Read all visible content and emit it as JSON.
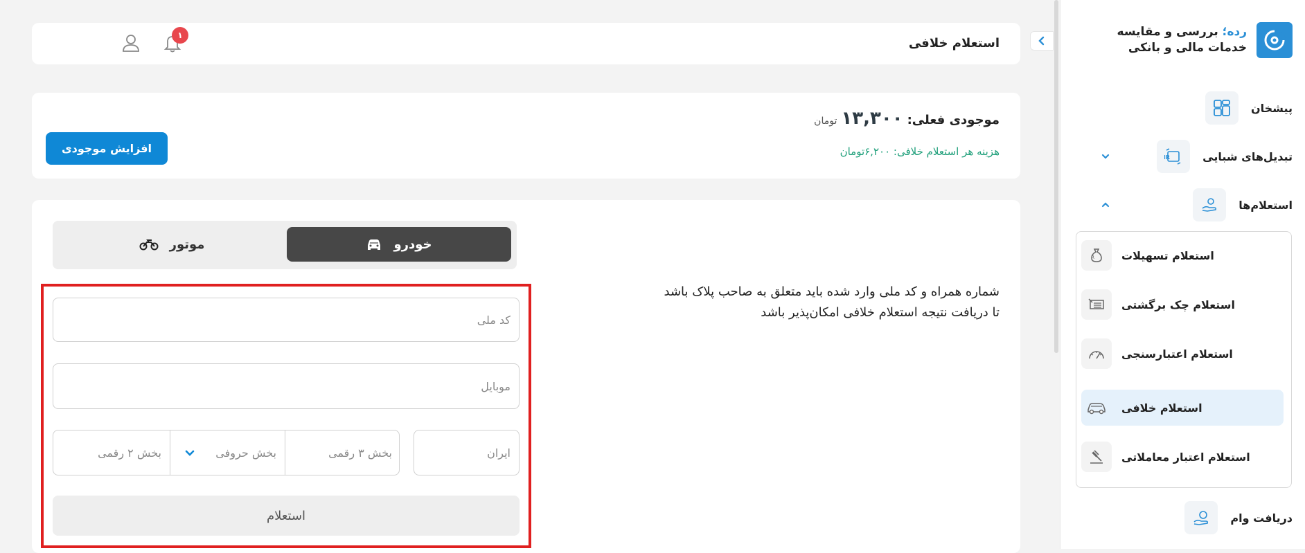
{
  "brand": {
    "accent": "رده؛",
    "line1_rest": "بررسی و مقایسه",
    "line2": "خدمات مالی و بانکی",
    "logo_icon": "disc-logo-icon"
  },
  "sidebar": {
    "items": [
      {
        "label": "پیشخان",
        "icon": "dashboard-icon"
      },
      {
        "label": "تبدیل‌های شبایی",
        "icon": "iban-convert-icon",
        "chevron": "down"
      },
      {
        "label": "استعلام‌ها",
        "icon": "hand-coin-icon",
        "chevron": "up"
      }
    ],
    "submenu": [
      {
        "label": "استعلام تسهیلات",
        "icon": "money-bag-icon"
      },
      {
        "label": "استعلام چک برگشتی",
        "icon": "cheque-icon"
      },
      {
        "label": "استعلام اعتبارسنجی",
        "icon": "gauge-icon"
      },
      {
        "label": "استعلام خلافی",
        "icon": "car-icon",
        "active": true
      },
      {
        "label": "استعلام اعتبار معاملاتی",
        "icon": "gavel-icon"
      }
    ],
    "bottom_item": {
      "label": "دریافت وام",
      "icon": "loan-icon"
    }
  },
  "header": {
    "title": "استعلام خلافی",
    "notification_count": "۱"
  },
  "balance": {
    "label": "موجودی فعلی:",
    "amount": "۱۳,۳۰۰",
    "unit": "تومان",
    "cost_text": "هزینه هر استعلام خلافی: ۶,۲۰۰تومان",
    "topup_label": "افزایش موجودی"
  },
  "tabs": {
    "car": "خودرو",
    "motor": "موتور"
  },
  "notice": {
    "line1": "شماره همراه و کد ملی وارد شده باید متعلق به صاحب پلاک باشد",
    "line2": "تا دریافت نتیجه استعلام خلافی امکان‌پذیر باشد"
  },
  "form": {
    "national_code_placeholder": "کد ملی",
    "mobile_placeholder": "موبایل",
    "plate_3digit": "بخش ۳ رقمی",
    "plate_letter": "بخش حروفی",
    "plate_2digit": "بخش ۲ رقمی",
    "plate_iran": "ایران",
    "submit_label": "استعلام"
  },
  "colors": {
    "accent": "#0f88d6",
    "active_tab": "#474747",
    "cost_green": "#1e9f7a",
    "badge_red": "#e8474d",
    "highlight_frame": "#e02020"
  }
}
